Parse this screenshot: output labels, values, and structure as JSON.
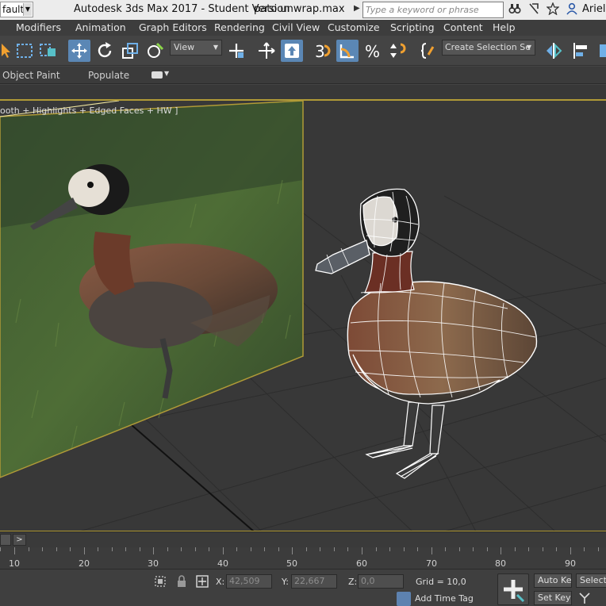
{
  "titlebar": {
    "workspace": "fault",
    "app_title": "Autodesk 3ds Max 2017 - Student Version",
    "file_name": "pato unwrap.max",
    "search_placeholder": "Type a keyword or phrase",
    "user": "ArielG"
  },
  "menu": [
    "Modifiers",
    "Animation",
    "Graph Editors",
    "Rendering",
    "Civil View",
    "Customize",
    "Scripting",
    "Content",
    "Help"
  ],
  "toolbar": {
    "reference_coord": "View",
    "named_selection": "Create Selection Se"
  },
  "ribbon": {
    "tabs": [
      "Object Paint",
      "Populate"
    ]
  },
  "viewport": {
    "label": "ooth + Highlights + Edged Faces + HW ]",
    "highlight_color": "#b09a37"
  },
  "timeline": {
    "next_label": ">",
    "ticks": [
      "10",
      "20",
      "30",
      "40",
      "50",
      "60",
      "70",
      "80",
      "90"
    ]
  },
  "status": {
    "x_label": "X:",
    "x_value": "42,509",
    "y_label": "Y:",
    "y_value": "22,667",
    "z_label": "Z:",
    "z_value": "0,0",
    "grid": "Grid = 10,0",
    "add_time_tag": "Add Time Tag",
    "auto_key": "Auto Key",
    "set_key": "Set Key",
    "selected": "Selecte"
  }
}
